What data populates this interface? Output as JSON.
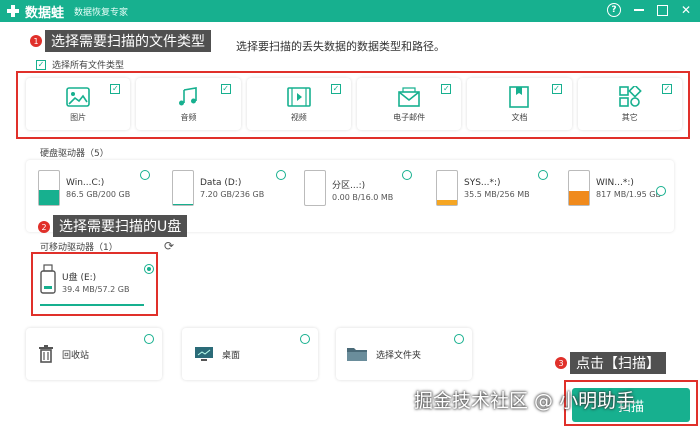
{
  "app": {
    "name": "数据蛙",
    "subtitle": "数据恢复专家"
  },
  "window_controls": {
    "help": "?"
  },
  "annotations": {
    "step1": {
      "num": "1",
      "text": "选择需要扫描的文件类型"
    },
    "step2": {
      "num": "2",
      "text": "选择需要扫描的U盘"
    },
    "step3": {
      "num": "3",
      "text": "点击【扫描】"
    }
  },
  "instruction": "选择要扫描的丢失数据的数据类型和路径。",
  "select_all_label": "选择所有文件类型",
  "file_types": [
    {
      "label": "图片",
      "icon": "image-icon",
      "checked": true
    },
    {
      "label": "音频",
      "icon": "music-icon",
      "checked": true
    },
    {
      "label": "视频",
      "icon": "video-icon",
      "checked": true
    },
    {
      "label": "电子邮件",
      "icon": "email-icon",
      "checked": true
    },
    {
      "label": "文档",
      "icon": "document-icon",
      "checked": true
    },
    {
      "label": "其它",
      "icon": "other-icon",
      "checked": true
    }
  ],
  "hard_drives": {
    "title": "硬盘驱动器（5）",
    "items": [
      {
        "name": "Win...C:)",
        "size": "86.5 GB/200 GB",
        "fill": 0.43,
        "color": "#17b08f"
      },
      {
        "name": "Data (D:)",
        "size": "7.20 GB/236 GB",
        "fill": 0.03,
        "color": "#17b08f"
      },
      {
        "name": "分区...:)",
        "size": "0.00  B/16.0 MB",
        "fill": 0.0,
        "color": "#17b08f"
      },
      {
        "name": "SYS...*:)",
        "size": "35.5 MB/256 MB",
        "fill": 0.14,
        "color": "#f5a623"
      },
      {
        "name": "WIN...*:)",
        "size": "817 MB/1.95 GB",
        "fill": 0.42,
        "color": "#f08a1c"
      }
    ]
  },
  "removable_drives": {
    "title": "可移动驱动器（1）",
    "items": [
      {
        "name": "U盘 (E:)",
        "size": "39.4 MB/57.2 GB",
        "selected": true
      }
    ]
  },
  "locations": [
    {
      "label": "回收站",
      "icon": "recycle-bin-icon"
    },
    {
      "label": "桌面",
      "icon": "desktop-icon"
    },
    {
      "label": "选择文件夹",
      "icon": "folder-icon"
    }
  ],
  "scan_button": "扫描",
  "watermark": "掘金技术社区 @ 小明助手",
  "colors": {
    "accent": "#17b08f",
    "annotation_red": "#e0302a"
  }
}
